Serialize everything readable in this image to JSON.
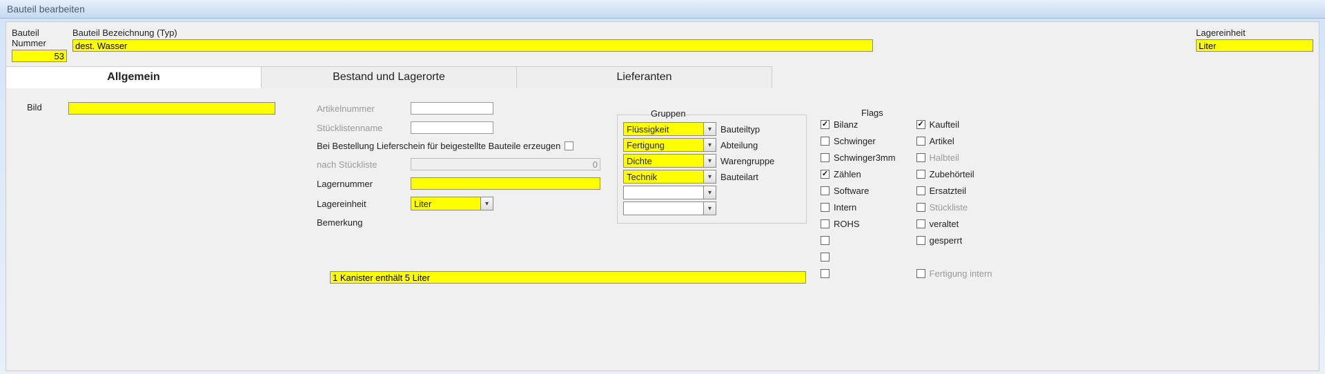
{
  "title": "Bauteil bearbeiten",
  "header": {
    "nummer_label": "Bauteil Nummer",
    "nummer": "53",
    "bez_label": "Bauteil Bezeichnung (Typ)",
    "bez": "dest. Wasser",
    "lager_label": "Lagereinheit",
    "lager": "Liter"
  },
  "tabs": {
    "t1": "Allgemein",
    "t2": "Bestand und Lagerorte",
    "t3": "Lieferanten"
  },
  "bild_label": "Bild",
  "mid": {
    "artikelnr": "Artikelnummer",
    "stuecklistenname": "Stücklistenname",
    "bestellung_text": "Bei Bestellung Lieferschein für beigestellte Bauteile erzeugen",
    "nach_stueckliste": "nach Stückliste",
    "nach_stueckliste_val": "0",
    "lagernummer": "Lagernummer",
    "lagernummer_val": "",
    "lagereinheit": "Lagereinheit",
    "lagereinheit_val": "Liter",
    "bemerkung": "Bemerkung",
    "bemerkung_val": "1 Kanister enthält 5 Liter"
  },
  "gruppen": {
    "title": "Gruppen",
    "rows": [
      {
        "val": "Flüssigkeit",
        "label": "Bauteiltyp",
        "yellow": true
      },
      {
        "val": "Fertigung",
        "label": "Abteilung",
        "yellow": true
      },
      {
        "val": "Dichte",
        "label": "Warengruppe",
        "yellow": true
      },
      {
        "val": "Technik",
        "label": "Bauteilart",
        "yellow": true
      },
      {
        "val": "",
        "label": "",
        "yellow": false
      },
      {
        "val": "",
        "label": "",
        "yellow": false
      }
    ]
  },
  "flags": {
    "title": "Flags",
    "col1": [
      {
        "label": "Bilanz",
        "checked": true
      },
      {
        "label": "Schwinger",
        "checked": false
      },
      {
        "label": "Schwinger3mm",
        "checked": false
      },
      {
        "label": "Zählen",
        "checked": true
      },
      {
        "label": "Software",
        "checked": false
      },
      {
        "label": "Intern",
        "checked": false
      },
      {
        "label": "ROHS",
        "checked": false
      },
      {
        "label": "",
        "checked": false
      },
      {
        "label": "",
        "checked": false
      },
      {
        "label": "",
        "checked": false
      }
    ],
    "col2": [
      {
        "label": "Kaufteil",
        "checked": true
      },
      {
        "label": "Artikel",
        "checked": false
      },
      {
        "label": "Halbteil",
        "checked": false,
        "ghost": true
      },
      {
        "label": "Zubehörteil",
        "checked": false
      },
      {
        "label": "Ersatzteil",
        "checked": false
      },
      {
        "label": "Stückliste",
        "checked": false,
        "ghost": true
      },
      {
        "label": "veraltet",
        "checked": false
      },
      {
        "label": "gesperrt",
        "checked": false
      },
      {
        "label": "",
        "checked": false,
        "hidden": true
      },
      {
        "label": "Fertigung intern",
        "checked": false,
        "ghost": true
      }
    ]
  }
}
